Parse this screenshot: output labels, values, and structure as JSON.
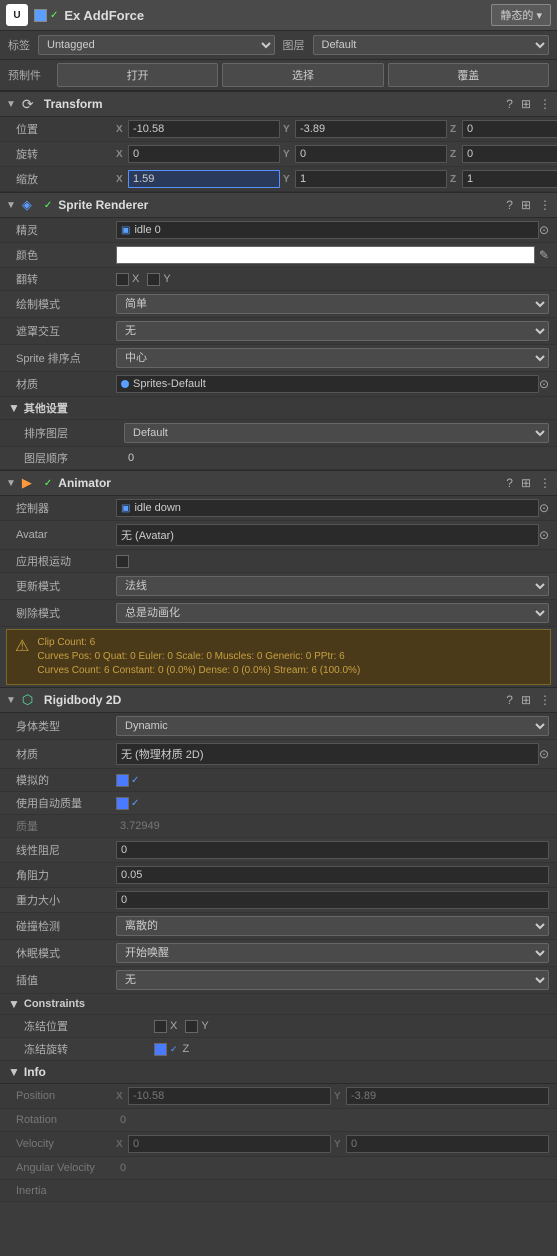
{
  "header": {
    "logo": "U",
    "checkbox_label": "✓",
    "obj_name": "Ex AddForce",
    "static_label": "静态的 ▾"
  },
  "tag_row": {
    "tag_label": "标签",
    "tag_value": "Untagged",
    "layer_label": "图层",
    "layer_value": "Default"
  },
  "prefab_row": {
    "prefab_label": "预制件",
    "open_label": "打开",
    "select_label": "选择",
    "cover_label": "覆盖"
  },
  "transform": {
    "title": "Transform",
    "pos_label": "位置",
    "pos_x": "-10.58",
    "pos_y": "-3.89",
    "pos_z": "0",
    "rot_label": "旋转",
    "rot_x": "0",
    "rot_y": "0",
    "rot_z": "0",
    "scale_label": "缩放",
    "scale_x": "1.59",
    "scale_y": "1",
    "scale_z": "1"
  },
  "sprite_renderer": {
    "title": "Sprite Renderer",
    "sprite_label": "精灵",
    "sprite_value": "idle 0",
    "color_label": "颜色",
    "flip_label": "翻转",
    "flip_x": "X",
    "flip_y": "Y",
    "draw_mode_label": "绘制模式",
    "draw_mode_value": "简单",
    "mask_label": "遮罩交互",
    "mask_value": "无",
    "sort_point_label": "Sprite 排序点",
    "sort_point_value": "中心",
    "material_label": "材质",
    "material_value": "Sprites-Default",
    "other_settings": "其他设置",
    "sort_layer_label": "排序图层",
    "sort_layer_value": "Default",
    "order_label": "图层顺序",
    "order_value": "0"
  },
  "animator": {
    "title": "Animator",
    "controller_label": "控制器",
    "controller_value": "idle down",
    "avatar_label": "Avatar",
    "avatar_value": "无 (Avatar)",
    "apply_root_label": "应用根运动",
    "update_mode_label": "更新模式",
    "update_mode_value": "法线",
    "culling_label": "剔除模式",
    "culling_value": "总是动画化",
    "warn_text": "Clip Count: 6\nCurves Pos: 0 Quat: 0 Euler: 0 Scale: 0 Muscles: 0 Generic: 0 PPtr: 6\nCurves Count: 6 Constant: 0 (0.0%) Dense: 0 (0.0%) Stream: 6 (100.0%)"
  },
  "rigidbody2d": {
    "title": "Rigidbody 2D",
    "body_type_label": "身体类型",
    "body_type_value": "Dynamic",
    "material_label": "材质",
    "material_value": "无 (物理材质 2D)",
    "simulated_label": "模拟的",
    "auto_mass_label": "使用自动质量",
    "mass_label": "质量",
    "mass_value": "3.72949",
    "linear_drag_label": "线性阻尼",
    "linear_drag_value": "0",
    "angular_drag_label": "角阻力",
    "angular_drag_value": "0.05",
    "gravity_label": "重力大小",
    "gravity_value": "0",
    "collision_label": "碰撞检测",
    "collision_value": "离散的",
    "sleep_label": "休眠模式",
    "sleep_value": "开始唤醒",
    "interpolate_label": "插值",
    "interpolate_value": "无",
    "constraints_label": "Constraints",
    "freeze_pos_label": "冻结位置",
    "freeze_pos_x": "X",
    "freeze_pos_y": "Y",
    "freeze_rot_label": "冻结旋转",
    "freeze_rot_z": "Z",
    "info_label": "Info",
    "position_label": "Position",
    "position_x": "-10.58",
    "position_y": "-3.89",
    "rotation_label": "Rotation",
    "rotation_value": "0",
    "velocity_label": "Velocity",
    "velocity_x": "0",
    "velocity_y": "0",
    "ang_vel_label": "Angular Velocity",
    "ang_vel_value": "0",
    "inertia_label": "Inertia"
  }
}
